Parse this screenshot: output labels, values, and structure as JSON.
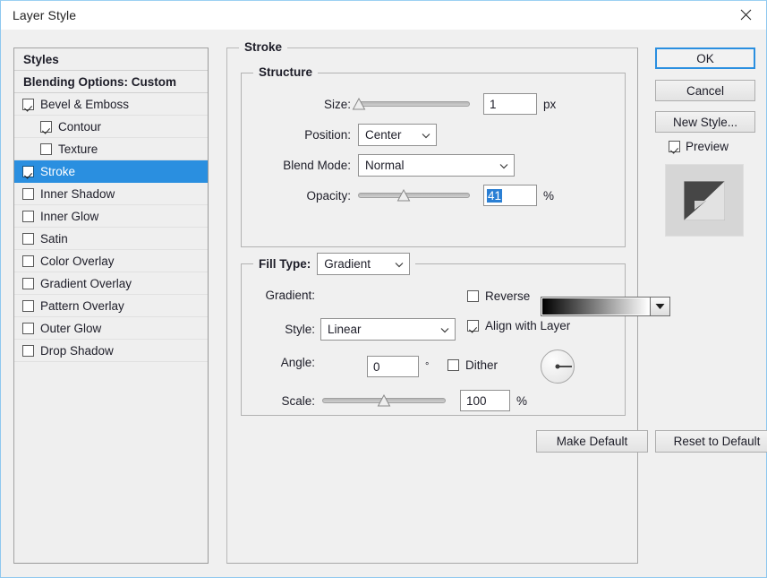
{
  "window": {
    "title": "Layer Style",
    "close_icon": "close-icon",
    "accent": "#2a8fe0",
    "selection_blue": "#2a7fd4",
    "bg": "#f0f0f0"
  },
  "styles_panel": {
    "header": "Styles",
    "blending_options": "Blending Options: Custom",
    "items": [
      {
        "label": "Bevel & Emboss",
        "checked": true,
        "indent": false,
        "selected": false
      },
      {
        "label": "Contour",
        "checked": true,
        "indent": true,
        "selected": false
      },
      {
        "label": "Texture",
        "checked": false,
        "indent": true,
        "selected": false
      },
      {
        "label": "Stroke",
        "checked": true,
        "indent": false,
        "selected": true
      },
      {
        "label": "Inner Shadow",
        "checked": false,
        "indent": false,
        "selected": false
      },
      {
        "label": "Inner Glow",
        "checked": false,
        "indent": false,
        "selected": false
      },
      {
        "label": "Satin",
        "checked": false,
        "indent": false,
        "selected": false
      },
      {
        "label": "Color Overlay",
        "checked": false,
        "indent": false,
        "selected": false
      },
      {
        "label": "Gradient Overlay",
        "checked": false,
        "indent": false,
        "selected": false
      },
      {
        "label": "Pattern Overlay",
        "checked": false,
        "indent": false,
        "selected": false
      },
      {
        "label": "Outer Glow",
        "checked": false,
        "indent": false,
        "selected": false
      },
      {
        "label": "Drop Shadow",
        "checked": false,
        "indent": false,
        "selected": false
      }
    ]
  },
  "stroke": {
    "title": "Stroke",
    "structure": {
      "title": "Structure",
      "size_label": "Size:",
      "size_value": "1",
      "size_unit": "px",
      "size_slider_percent": 1,
      "position_label": "Position:",
      "position_value": "Center",
      "blend_mode_label": "Blend Mode:",
      "blend_mode_value": "Normal",
      "opacity_label": "Opacity:",
      "opacity_value": "41",
      "opacity_unit": "%",
      "opacity_slider_percent": 41
    },
    "fill": {
      "fill_type_label": "Fill Type:",
      "fill_type_value": "Gradient",
      "gradient_label": "Gradient:",
      "gradient_from": "#000000",
      "gradient_to": "#ffffff",
      "reverse_label": "Reverse",
      "reverse_checked": false,
      "style_label": "Style:",
      "style_value": "Linear",
      "align_label": "Align with Layer",
      "align_checked": true,
      "angle_label": "Angle:",
      "angle_value": "0",
      "angle_unit": "°",
      "dither_label": "Dither",
      "dither_checked": false,
      "scale_label": "Scale:",
      "scale_value": "100",
      "scale_unit": "%",
      "scale_slider_percent": 50
    },
    "make_default": "Make Default",
    "reset_default": "Reset to Default"
  },
  "actions": {
    "ok": "OK",
    "cancel": "Cancel",
    "new_style": "New Style...",
    "preview_label": "Preview",
    "preview_checked": true
  }
}
